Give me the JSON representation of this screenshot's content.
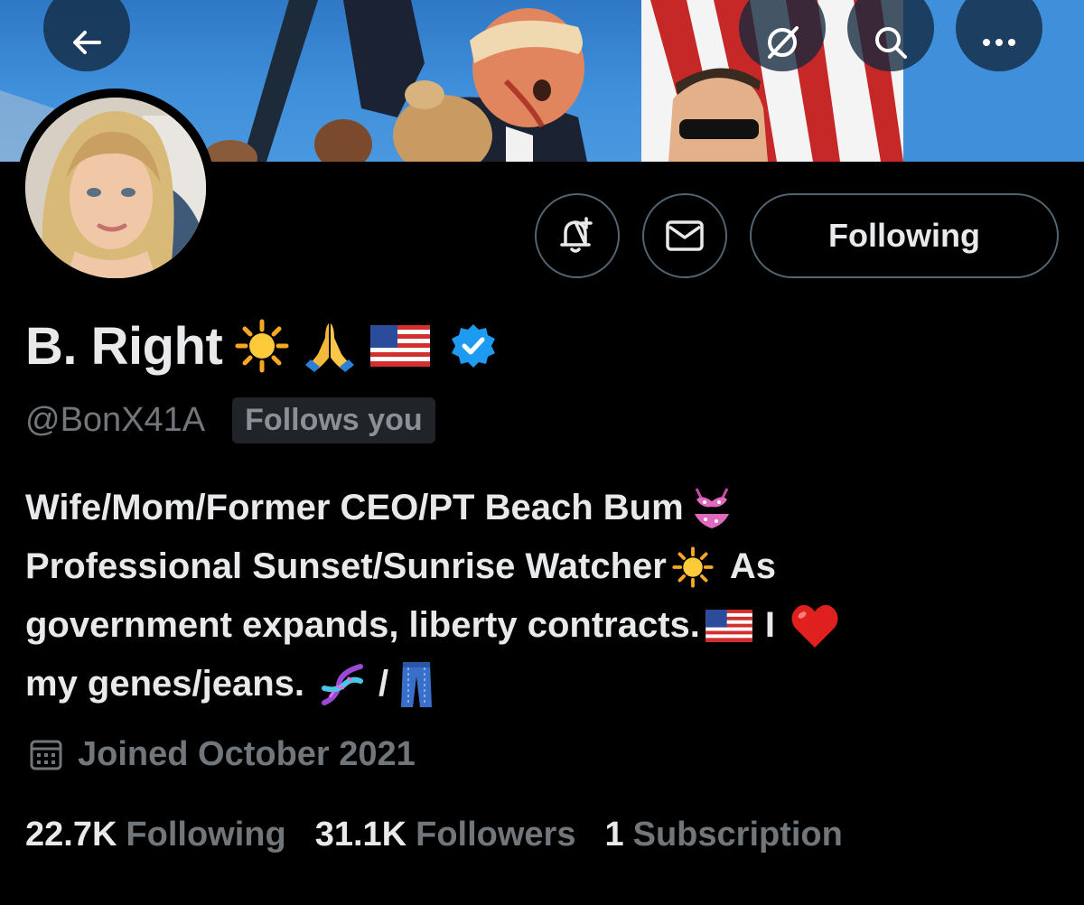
{
  "header": {
    "back_icon": "arrow-left-icon",
    "grok_icon": "grok-icon",
    "search_icon": "search-icon",
    "more_icon": "more-icon"
  },
  "actions": {
    "notify_icon": "bell-plus-icon",
    "message_icon": "envelope-icon",
    "follow_label": "Following"
  },
  "profile": {
    "display_name": "B. Right",
    "name_emojis": [
      "sun-emoji",
      "praying-hands-emoji",
      "us-flag-emoji"
    ],
    "verified": true,
    "handle": "@BonX41A",
    "follows_you_label": "Follows you",
    "bio": {
      "line1": "Wife/Mom/Former CEO/PT Beach Bum",
      "line2": "Professional Sunset/Sunrise Watcher",
      "line2_tail": "As",
      "line3": "government expands, liberty contracts.",
      "line3_tail": "I",
      "line4": "my genes/jeans.",
      "line4_sep": "/"
    },
    "joined": "Joined October 2021"
  },
  "stats": [
    {
      "count": "22.7K",
      "label": "Following"
    },
    {
      "count": "31.1K",
      "label": "Followers"
    },
    {
      "count": "1",
      "label": "Subscription"
    }
  ],
  "colors": {
    "background": "#000000",
    "text_primary": "#e7e9ea",
    "text_secondary": "#71767b",
    "verified_blue": "#1d9bf0",
    "button_border": "#536471"
  }
}
